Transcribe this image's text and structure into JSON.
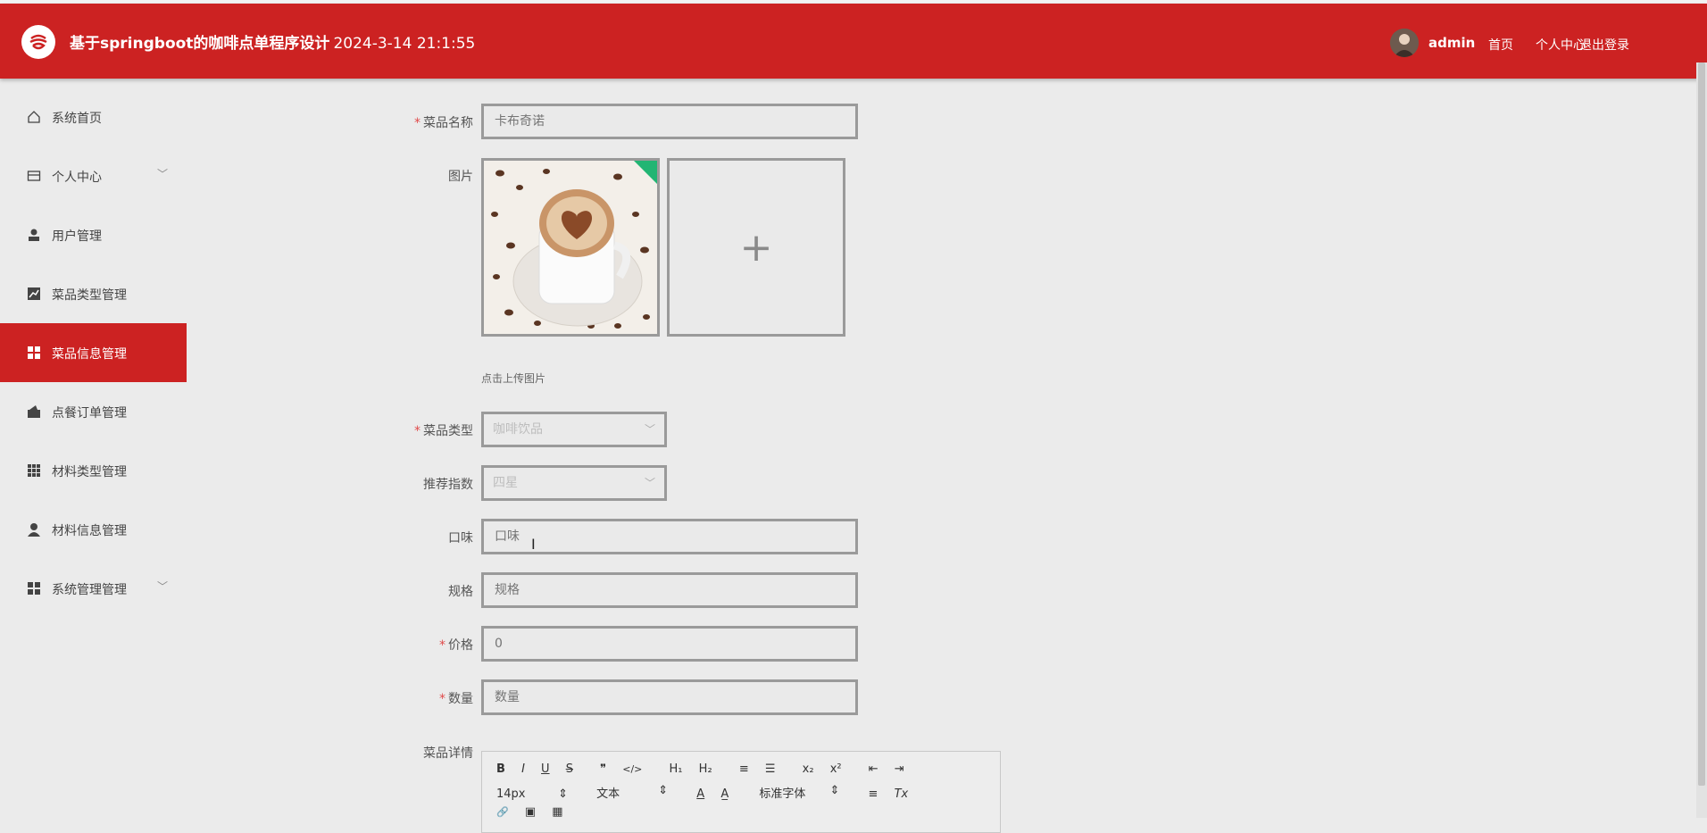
{
  "header": {
    "title": "基于springboot的咖啡点单程序设计",
    "datetime": "2024-3-14 21:1:55",
    "username": "admin",
    "nav": [
      "首页",
      "个人中心",
      "退出登录"
    ]
  },
  "sidebar": {
    "items": [
      {
        "label": "系统首页",
        "icon": "home-icon",
        "expandable": false,
        "active": false
      },
      {
        "label": "个人中心",
        "icon": "card-icon",
        "expandable": true,
        "active": false
      },
      {
        "label": "用户管理",
        "icon": "user-icon",
        "expandable": false,
        "active": false
      },
      {
        "label": "菜品类型管理",
        "icon": "chart-icon",
        "expandable": false,
        "active": false
      },
      {
        "label": "菜品信息管理",
        "icon": "grid-icon",
        "expandable": false,
        "active": true
      },
      {
        "label": "点餐订单管理",
        "icon": "wallet-icon",
        "expandable": false,
        "active": false
      },
      {
        "label": "材料类型管理",
        "icon": "apps-icon",
        "expandable": false,
        "active": false
      },
      {
        "label": "材料信息管理",
        "icon": "person-icon",
        "expandable": false,
        "active": false
      },
      {
        "label": "系统管理管理",
        "icon": "grid-icon",
        "expandable": true,
        "active": false
      }
    ]
  },
  "form": {
    "name": {
      "label": "菜品名称",
      "required": true,
      "placeholder": "卡布奇诺",
      "value": ""
    },
    "image": {
      "label": "图片",
      "upload_tip": "点击上传图片",
      "add_symbol": "+"
    },
    "type": {
      "label": "菜品类型",
      "required": true,
      "value": "咖啡饮品"
    },
    "recommend": {
      "label": "推荐指数",
      "required": false,
      "value": "四星"
    },
    "taste": {
      "label": "口味",
      "required": false,
      "placeholder": "口味"
    },
    "spec": {
      "label": "规格",
      "required": false,
      "placeholder": "规格"
    },
    "price": {
      "label": "价格",
      "required": true,
      "placeholder": "0"
    },
    "quantity": {
      "label": "数量",
      "required": true,
      "placeholder": "数量"
    },
    "detail": {
      "label": "菜品详情"
    }
  },
  "editor": {
    "row1": [
      "B",
      "I",
      "U",
      "S",
      "❞",
      "</>",
      "H₁",
      "H₂",
      "≡",
      "☰",
      "x₂",
      "x²",
      "⇤",
      "⇥"
    ],
    "font_size": "14px",
    "text_style": "文本",
    "font_family": "标准字体",
    "row2_extra": [
      "A",
      "A̲",
      "≡",
      "Tx"
    ],
    "row3": [
      "🔗",
      "▣",
      "▦"
    ]
  },
  "colors": {
    "primary": "#cc2222",
    "background": "#ebebeb"
  }
}
